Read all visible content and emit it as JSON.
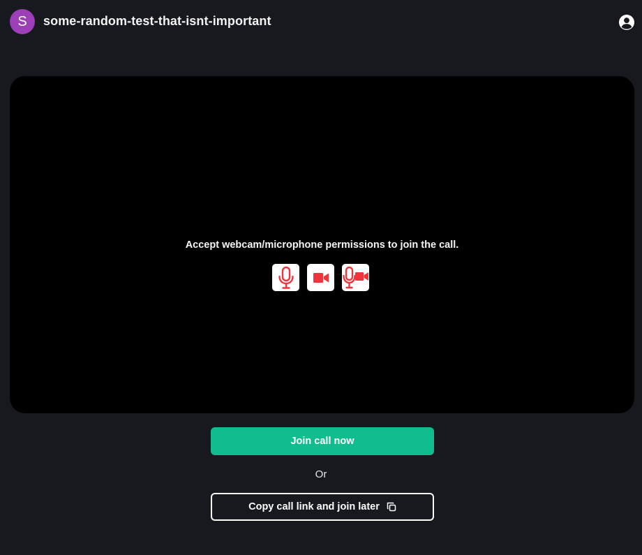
{
  "header": {
    "avatar_letter": "S",
    "avatar_color": "#9c3fb8",
    "room_name": "some-random-test-that-isnt-important",
    "account_icon": "account-circle-icon"
  },
  "preview": {
    "permission_message": "Accept webcam/microphone permissions to join the call.",
    "buttons": [
      {
        "icon": "microphone-icon"
      },
      {
        "icon": "camera-icon"
      },
      {
        "icon": "microphone-camera-icon"
      }
    ],
    "icon_color": "#f0343b"
  },
  "actions": {
    "join_label": "Join call now",
    "join_color": "#10bd8e",
    "or_label": "Or",
    "copy_label": "Copy call link and join later",
    "copy_icon": "copy-icon"
  }
}
